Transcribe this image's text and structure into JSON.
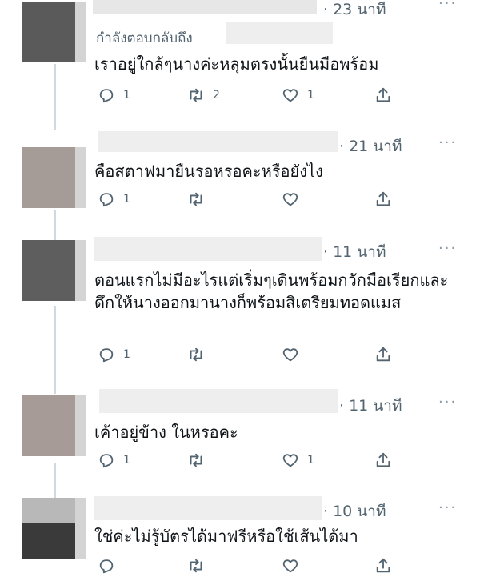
{
  "tweets": [
    {
      "timestamp": "· 23 นาที",
      "replying_to": "กำลังตอบกลับถึง",
      "text": "เราอยู่ใกล้ๆนางค่ะหลุมตรงนั้นยืนมือพร้อม",
      "replies": "1",
      "retweets": "2",
      "likes": "1",
      "avatar_color": "#5a5a5a"
    },
    {
      "timestamp": "· 21 นาที",
      "text": "คือสตาฟมายืนรอหรอคะหรือยังไง",
      "replies": "1",
      "retweets": "",
      "likes": "",
      "avatar_color": "#a59c98"
    },
    {
      "timestamp": "· 11 นาที",
      "text": "ตอนแรกไม่มีอะไรแต่เริ่มๆเดินพร้อมกวักมือเรียกและดึกให้นางออกมานางก็พร้อมสิเตรียมทอดแมส",
      "replies": "1",
      "retweets": "",
      "likes": "",
      "avatar_color": "#5e5e5e"
    },
    {
      "timestamp": "· 11 นาที",
      "text": "เค้าอยู่ข้าง ในหรอคะ",
      "replies": "1",
      "retweets": "",
      "likes": "1",
      "avatar_color": "#a69b97"
    },
    {
      "timestamp": "· 10 นาที",
      "text": "ใช่ค่ะไม่รู้บัตรได้มาฟรีหรือใช้เส้นได้มา",
      "replies": "",
      "retweets": "",
      "likes": "",
      "avatar_color": "#3a3a3a"
    }
  ],
  "more_label": "···",
  "icons": {
    "reply": "reply-icon",
    "retweet": "retweet-icon",
    "like": "heart-icon",
    "share": "share-icon"
  }
}
